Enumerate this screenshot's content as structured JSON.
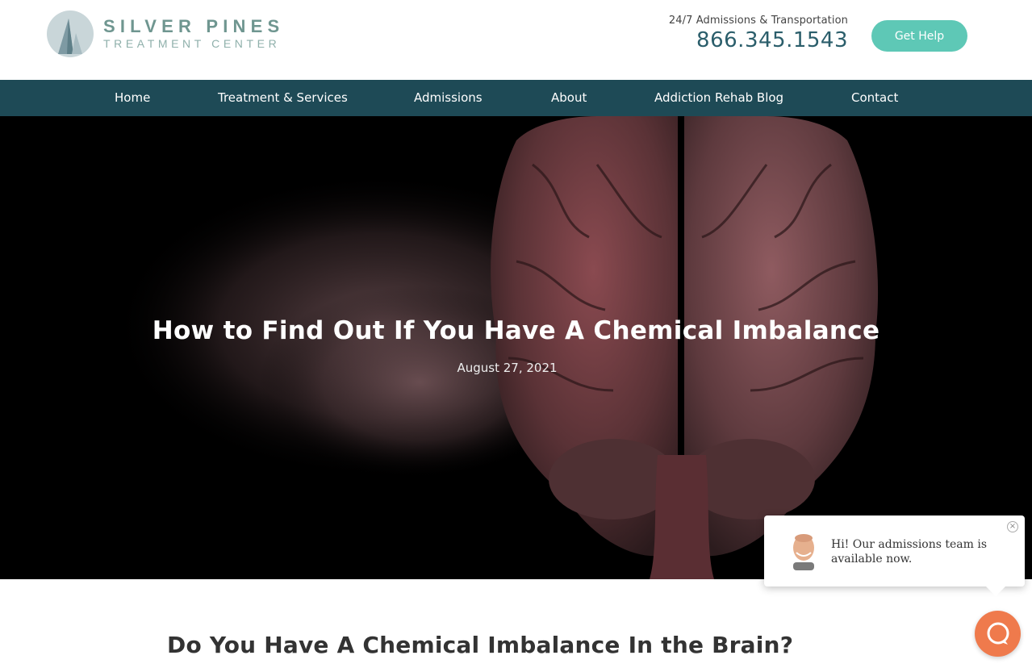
{
  "logo": {
    "line1": "SILVER PINES",
    "line2": "TREATMENT CENTER",
    "icon": "pine-tree-logo-icon"
  },
  "contact": {
    "tagline": "24/7 Admissions & Transportation",
    "phone": "866.345.1543"
  },
  "cta": {
    "label": "Get Help"
  },
  "nav": {
    "items": [
      {
        "label": "Home"
      },
      {
        "label": "Treatment & Services"
      },
      {
        "label": "Admissions"
      },
      {
        "label": "About"
      },
      {
        "label": "Addiction Rehab Blog"
      },
      {
        "label": "Contact"
      }
    ]
  },
  "hero": {
    "title": "How to Find Out If You Have A Chemical Imbalance",
    "date": "August 27, 2021"
  },
  "content": {
    "heading": "Do You Have A Chemical Imbalance In the Brain?"
  },
  "chat": {
    "message": "Hi! Our admissions team is available now.",
    "close_icon": "close-icon",
    "launcher_icon": "chat-bubble-icon"
  },
  "colors": {
    "brand_teal": "#6f9690",
    "nav_bg": "#1e4a56",
    "phone_color": "#2b5e6b",
    "cta_bg": "#5ec8b6",
    "chat_launcher_bg": "#ef7a4c"
  }
}
